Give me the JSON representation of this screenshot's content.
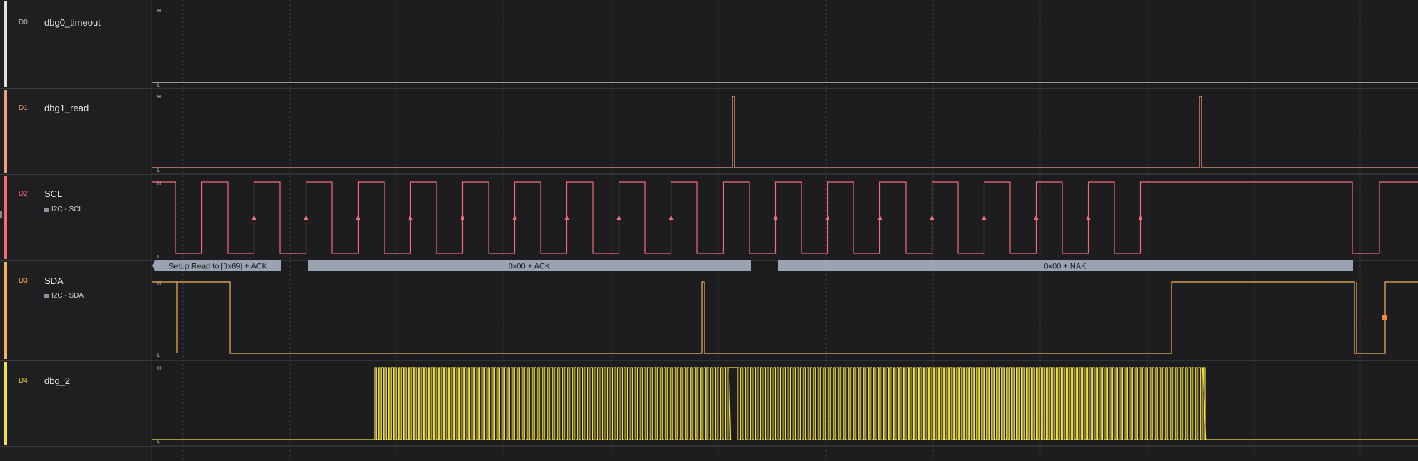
{
  "channels": [
    {
      "id": "D0",
      "name": "dbg0_timeout",
      "color": "#e0e0e0",
      "id_color": "#bfbfbf"
    },
    {
      "id": "D1",
      "name": "dbg1_read",
      "color": "#f0a080",
      "id_color": "#e98a62"
    },
    {
      "id": "D2",
      "name": "SCL",
      "color": "#f06b7c",
      "id_color": "#ef5f73",
      "analyzer": "I2C - SCL"
    },
    {
      "id": "D3",
      "name": "SDA",
      "color": "#f5b25a",
      "id_color": "#f3a24a",
      "analyzer": "I2C - SDA"
    },
    {
      "id": "D4",
      "name": "dbg_2",
      "color": "#f2e24a",
      "id_color": "#e8d43a"
    }
  ],
  "level_high": "H",
  "level_low": "L",
  "i2c_frames": [
    {
      "label": "Setup Read to [0x69] + ACK"
    },
    {
      "label": "0x00 + ACK"
    },
    {
      "label": "0x00 + NAK"
    }
  ],
  "colors": {
    "background": "#1d1d1f",
    "grid": "#3c3c40",
    "frame_bar": "#9aa3b2",
    "frame_text": "#1b1b1e"
  }
}
